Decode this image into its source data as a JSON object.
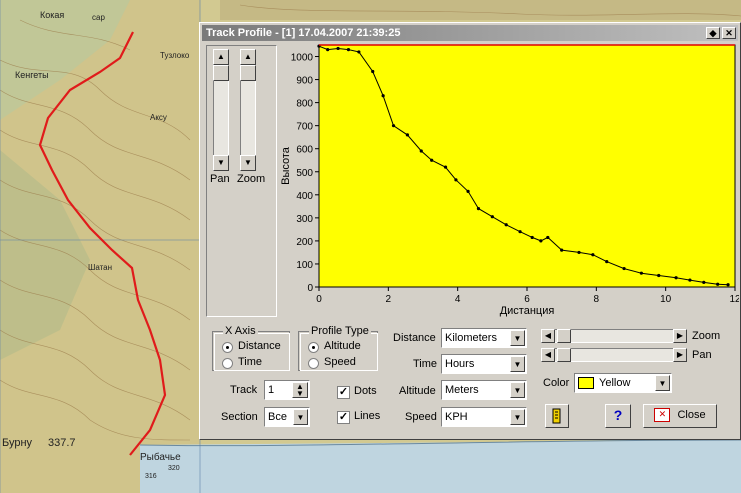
{
  "map": {
    "labels": [
      "Кокая",
      "сар",
      "Тузлоко",
      "Аксу",
      "Кенгеты",
      "Шатан",
      "Бурну",
      "337.7",
      "Рыбачье",
      "320",
      "316"
    ]
  },
  "window": {
    "title": "Track Profile - [1] 17.04.2007 21:39:25",
    "btn_restore": "◆",
    "btn_close": "✕"
  },
  "sliders": {
    "pan_label": "Pan",
    "zoom_label": "Zoom"
  },
  "xaxis_group": {
    "title": "X Axis",
    "options": [
      "Distance",
      "Time"
    ],
    "selected": 0
  },
  "profile_group": {
    "title": "Profile Type",
    "options": [
      "Altitude",
      "Speed"
    ],
    "selected": 0
  },
  "track": {
    "label": "Track",
    "value": "1"
  },
  "section": {
    "label": "Section",
    "value": "Все"
  },
  "dots": {
    "label": "Dots",
    "checked": true
  },
  "lines": {
    "label": "Lines",
    "checked": true
  },
  "units": {
    "distance_label": "Distance",
    "distance_value": "Kilometers",
    "time_label": "Time",
    "time_value": "Hours",
    "altitude_label": "Altitude",
    "altitude_value": "Meters",
    "speed_label": "Speed",
    "speed_value": "KPH"
  },
  "zoom_label": "Zoom",
  "pan_label": "Pan",
  "color": {
    "label": "Color",
    "value": "Yellow",
    "swatch": "#ffff00"
  },
  "buttons": {
    "help": "?",
    "close": "Close"
  },
  "chart_data": {
    "type": "line",
    "xlabel": "Дистанция",
    "ylabel": "Высота",
    "xlim": [
      0,
      12
    ],
    "ylim": [
      0,
      1050
    ],
    "xticks": [
      "0",
      "2",
      "4",
      "6",
      "8",
      "10",
      "12"
    ],
    "yticks": [
      "0",
      "100",
      "200",
      "300",
      "400",
      "500",
      "600",
      "700",
      "800",
      "900",
      "1000"
    ],
    "background": "#ffff00",
    "series": [
      {
        "x": [
          0,
          0.25,
          0.55,
          0.85,
          1.15,
          1.55,
          1.85,
          2.15,
          2.55,
          2.95,
          3.25,
          3.65,
          3.95,
          4.3,
          4.6,
          5.0,
          5.4,
          5.8,
          6.15,
          6.4,
          6.6,
          7.0,
          7.5,
          7.9,
          8.3,
          8.8,
          9.3,
          9.8,
          10.3,
          10.7,
          11.1,
          11.5,
          11.8
        ],
        "y": [
          1045,
          1030,
          1035,
          1030,
          1020,
          935,
          830,
          700,
          660,
          590,
          550,
          520,
          465,
          415,
          340,
          305,
          270,
          240,
          215,
          200,
          215,
          160,
          150,
          140,
          110,
          80,
          60,
          50,
          40,
          30,
          20,
          12,
          10
        ]
      }
    ]
  }
}
